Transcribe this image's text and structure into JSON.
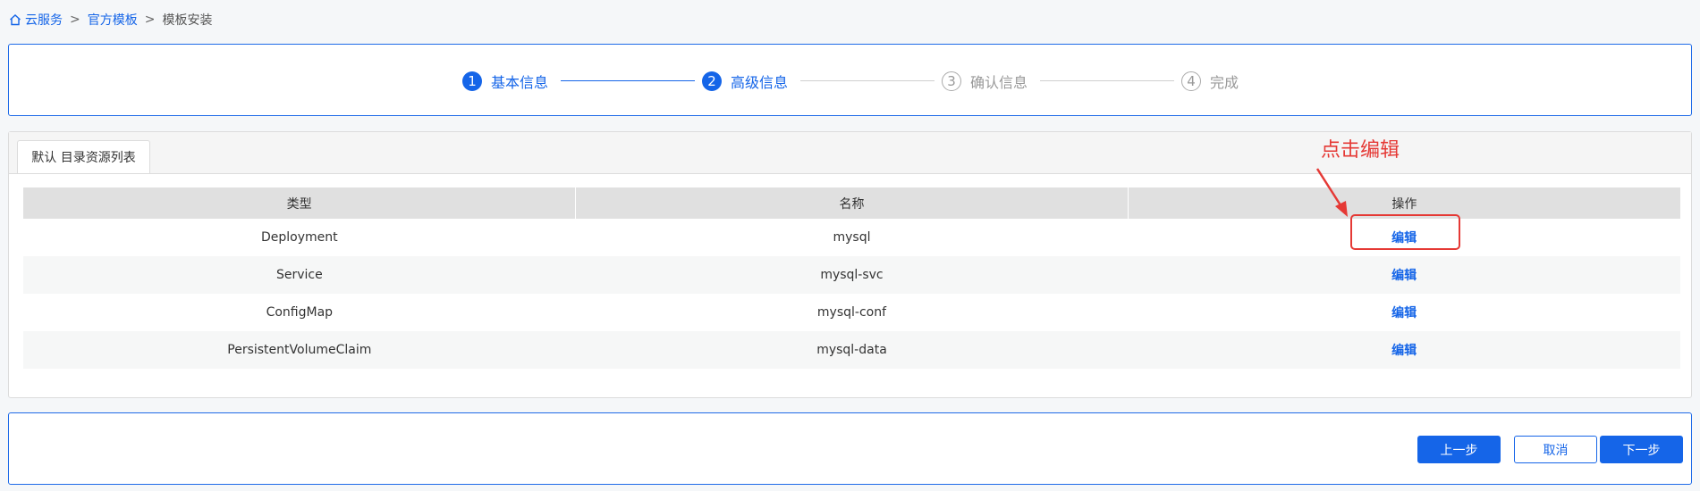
{
  "breadcrumb": {
    "items": [
      "云服务",
      "官方模板"
    ],
    "separator": ">",
    "current": "模板安装"
  },
  "steps": [
    {
      "num": "1",
      "label": "基本信息",
      "state": "active"
    },
    {
      "num": "2",
      "label": "高级信息",
      "state": "active"
    },
    {
      "num": "3",
      "label": "确认信息",
      "state": "pending"
    },
    {
      "num": "4",
      "label": "完成",
      "state": "pending"
    }
  ],
  "tabs": {
    "active": "默认 目录资源列表"
  },
  "table": {
    "headers": [
      "类型",
      "名称",
      "操作"
    ],
    "rows": [
      {
        "type": "Deployment",
        "name": "mysql",
        "action": "编辑"
      },
      {
        "type": "Service",
        "name": "mysql-svc",
        "action": "编辑"
      },
      {
        "type": "ConfigMap",
        "name": "mysql-conf",
        "action": "编辑"
      },
      {
        "type": "PersistentVolumeClaim",
        "name": "mysql-data",
        "action": "编辑"
      }
    ]
  },
  "annotation": {
    "text": "点击编辑",
    "color": "#e53935"
  },
  "footer": {
    "prev": "上一步",
    "cancel": "取消",
    "next": "下一步"
  },
  "colors": {
    "accent": "#1565e8",
    "pending": "#999999"
  }
}
